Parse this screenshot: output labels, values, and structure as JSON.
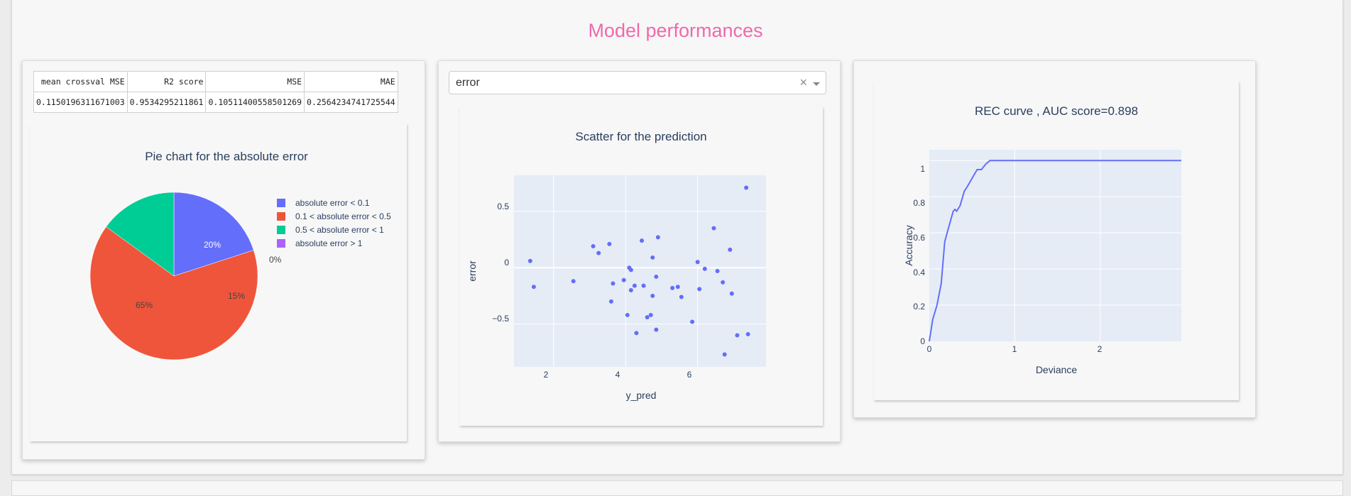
{
  "page_title": "Model performances",
  "metrics_table": {
    "headers": [
      "mean crossval MSE",
      "R2 score",
      "MSE",
      "MAE"
    ],
    "rows": [
      [
        "0.1150196311671003",
        "0.9534295211861",
        "0.10511400558501269",
        "0.2564234741725544"
      ]
    ]
  },
  "dropdown": {
    "value": "error",
    "clear_icon": "×"
  },
  "pie_chart": {
    "title": "Pie chart for the absolute error",
    "slice_labels": [
      "20%",
      "65%",
      "15%",
      "0%"
    ],
    "legend": [
      "absolute error < 0.1",
      "0.1 < absolute error < 0.5",
      "0.5 < absolute error < 1",
      "absolute error > 1"
    ]
  },
  "scatter_chart": {
    "title": "Scatter for the prediction",
    "xlabel": "y_pred",
    "ylabel": "error",
    "xticks": [
      "2",
      "4",
      "6"
    ],
    "yticks": [
      "0.5",
      "0",
      "−0.5"
    ]
  },
  "rec_chart": {
    "title": "REC curve , AUC score=0.898",
    "xlabel": "Deviance",
    "ylabel": "Accuracy",
    "xticks": [
      "0",
      "1",
      "2"
    ],
    "yticks": [
      "0",
      "0.2",
      "0.4",
      "0.6",
      "0.8",
      "1"
    ]
  },
  "colors": {
    "title": "#ee6aab",
    "slice1": "#636efa",
    "slice2": "#ef553b",
    "slice3": "#00cc96",
    "slice4": "#ab63fa",
    "plot_bg": "#e5ecf6",
    "marker": "#636efa"
  },
  "chart_data": [
    {
      "type": "pie",
      "title": "Pie chart for the absolute error",
      "labels": [
        "absolute error < 0.1",
        "0.1 < absolute error < 0.5",
        "0.5 < absolute error < 1",
        "absolute error > 1"
      ],
      "values": [
        20,
        65,
        15,
        0
      ],
      "colors": [
        "#636efa",
        "#ef553b",
        "#00cc96",
        "#ab63fa"
      ],
      "legend": "right"
    },
    {
      "type": "scatter",
      "title": "Scatter for the prediction",
      "xlabel": "y_pred",
      "ylabel": "error",
      "xlim": [
        0.9,
        7.9
      ],
      "ylim": [
        -0.88,
        0.82
      ],
      "points": [
        [
          1.35,
          0.06
        ],
        [
          1.45,
          -0.17
        ],
        [
          2.55,
          -0.12
        ],
        [
          3.1,
          0.19
        ],
        [
          3.25,
          0.13
        ],
        [
          3.55,
          0.21
        ],
        [
          3.6,
          -0.3
        ],
        [
          3.65,
          -0.14
        ],
        [
          3.95,
          -0.11
        ],
        [
          4.05,
          -0.42
        ],
        [
          4.1,
          0.0
        ],
        [
          4.15,
          -0.02
        ],
        [
          4.15,
          -0.2
        ],
        [
          4.25,
          -0.16
        ],
        [
          4.3,
          -0.58
        ],
        [
          4.45,
          0.24
        ],
        [
          4.5,
          -0.16
        ],
        [
          4.6,
          -0.44
        ],
        [
          4.7,
          -0.42
        ],
        [
          4.75,
          0.09
        ],
        [
          4.75,
          -0.25
        ],
        [
          4.85,
          -0.08
        ],
        [
          4.85,
          -0.55
        ],
        [
          4.9,
          0.27
        ],
        [
          5.3,
          -0.18
        ],
        [
          5.45,
          -0.17
        ],
        [
          5.55,
          -0.26
        ],
        [
          5.85,
          -0.48
        ],
        [
          6.0,
          0.05
        ],
        [
          6.05,
          -0.19
        ],
        [
          6.2,
          -0.01
        ],
        [
          6.45,
          0.35
        ],
        [
          6.55,
          -0.03
        ],
        [
          6.7,
          -0.13
        ],
        [
          6.75,
          -0.77
        ],
        [
          6.9,
          0.16
        ],
        [
          6.95,
          -0.23
        ],
        [
          7.1,
          -0.6
        ],
        [
          7.35,
          0.71
        ],
        [
          7.4,
          -0.59
        ]
      ]
    },
    {
      "type": "line",
      "title": "REC curve , AUC score=0.898",
      "xlabel": "Deviance",
      "ylabel": "Accuracy",
      "xlim": [
        0,
        2.95
      ],
      "ylim": [
        0,
        1.06
      ],
      "x": [
        0,
        0.04,
        0.09,
        0.14,
        0.18,
        0.22,
        0.28,
        0.3,
        0.32,
        0.36,
        0.41,
        0.45,
        0.51,
        0.56,
        0.61,
        0.66,
        0.71,
        0.76,
        0.8,
        2.95
      ],
      "y": [
        0,
        0.12,
        0.2,
        0.32,
        0.55,
        0.62,
        0.72,
        0.73,
        0.72,
        0.75,
        0.83,
        0.86,
        0.91,
        0.95,
        0.95,
        0.98,
        1.0,
        1.0,
        1.0,
        1.0
      ],
      "grid": true
    }
  ]
}
